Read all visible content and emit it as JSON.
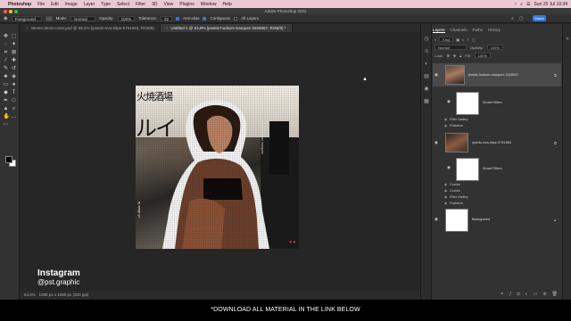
{
  "menubar": {
    "app_name": "Photoshop",
    "items": [
      "File",
      "Edit",
      "Image",
      "Layer",
      "Type",
      "Select",
      "Filter",
      "3D",
      "View",
      "Plugins",
      "Window",
      "Help"
    ],
    "datetime": "Sun 25 Jul  10:34"
  },
  "window": {
    "title": "Adobe Photoshop 2022"
  },
  "options": {
    "preset": "Foreground",
    "mode_label": "Mode:",
    "mode_value": "Normal",
    "opacity_label": "Opacity:",
    "opacity_value": "100%",
    "tolerance_label": "Tolerance:",
    "tolerance_value": "32",
    "antialias": "Anti-alias",
    "contiguous": "Contiguous",
    "all_layers": "All Layers"
  },
  "doc_tabs": [
    {
      "label": "steven-dexis-cover.psd @ 58,4% (ipsedo-eva-elipe-5761963, RGB/8)"
    },
    {
      "label": "Untitled-1 @ 54,9% (jeweis-hudson-marquez-3326067, RGB/8) *"
    }
  ],
  "status": {
    "zoom": "54,9%",
    "doc_size": "1080 px x 1080 px (300 ppi)"
  },
  "artwork": {
    "kanji_line1": "火焼酒場",
    "kanji_line2": "ルイ",
    "vertical_text": "jewels hudson marquez",
    "side_text": "v4 d0ulz fa",
    "stamp": "✦✦"
  },
  "panels": {
    "tabs": [
      "Layers",
      "Channels",
      "Paths",
      "History"
    ],
    "filter_kind": "Kind",
    "blend_mode": "Normal",
    "opacity_label": "Opacity:",
    "opacity_value": "100%",
    "lock_label": "Lock:",
    "fill_label": "Fill:",
    "fill_value": "100%"
  },
  "layers": [
    {
      "name": "jewels-hudson-marquez-3326067",
      "selected": true
    },
    {
      "name": "Smart Filters"
    },
    {
      "name": "Filter Gallery"
    },
    {
      "name": "Posterize"
    },
    {
      "name": "ipsedo-eva-elipe-5761963"
    },
    {
      "name": "Smart Filters"
    },
    {
      "name": "Curves"
    },
    {
      "name": "Curves"
    },
    {
      "name": "Filter Gallery"
    },
    {
      "name": "Posterize"
    },
    {
      "name": "Background"
    }
  ],
  "topbar": {
    "share_label": "Share"
  },
  "overlay": {
    "insta_title": "Instagram",
    "insta_handle": "@pst.graphic",
    "caption": "*DOWNLOAD ALL MATERIAL IN THE LINK BELOW"
  },
  "colors": {
    "accent": "#2f7be0",
    "menubar": "#ebc8d3",
    "panel": "#323232",
    "canvas": "#262626"
  }
}
